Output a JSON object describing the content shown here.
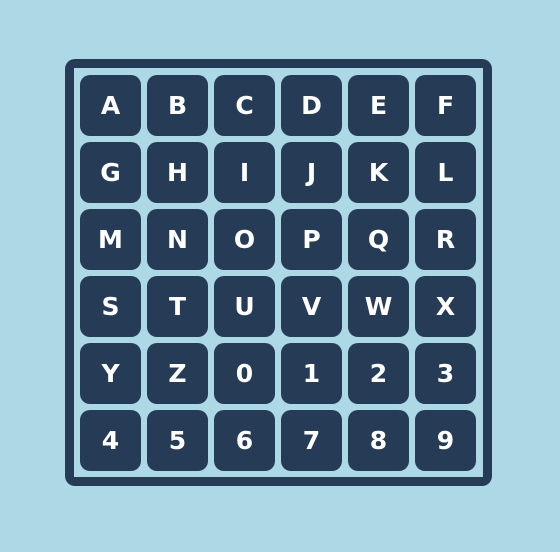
{
  "colors": {
    "background": "#add8e6",
    "board": "#263c56",
    "key": "#263c56",
    "key_text": "#ffffff"
  },
  "keys": [
    "A",
    "B",
    "C",
    "D",
    "E",
    "F",
    "G",
    "H",
    "I",
    "J",
    "K",
    "L",
    "M",
    "N",
    "O",
    "P",
    "Q",
    "R",
    "S",
    "T",
    "U",
    "V",
    "W",
    "X",
    "Y",
    "Z",
    "0",
    "1",
    "2",
    "3",
    "4",
    "5",
    "6",
    "7",
    "8",
    "9"
  ]
}
